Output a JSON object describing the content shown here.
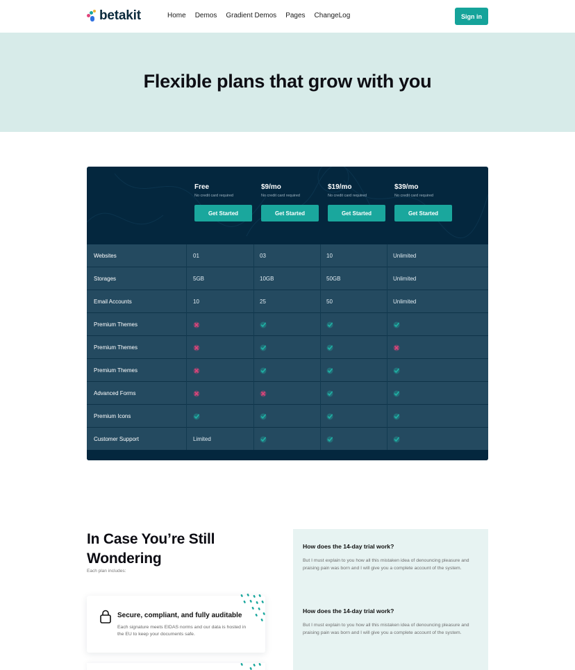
{
  "nav": {
    "logo_text": "betakit",
    "links": [
      "Home",
      "Demos",
      "Gradient Demos",
      "Pages",
      "ChangeLog"
    ],
    "signin_label": "Sign in"
  },
  "hero": {
    "title": "Flexible plans that grow with you"
  },
  "pricing": {
    "plans": [
      {
        "price": "Free",
        "note": "No credit card required",
        "button": "Get Started"
      },
      {
        "price": "$9/mo",
        "note": "No credit card required",
        "button": "Get Started"
      },
      {
        "price": "$19/mo",
        "note": "No credit card required",
        "button": "Get Started"
      },
      {
        "price": "$39/mo",
        "note": "No credit card required",
        "button": "Get Started"
      }
    ],
    "rows": [
      {
        "label": "Websites",
        "values": [
          "01",
          "03",
          "10",
          "Unlimited"
        ]
      },
      {
        "label": "Storages",
        "values": [
          "5GB",
          "10GB",
          "50GB",
          "Unlimited"
        ]
      },
      {
        "label": "Email Accounts",
        "values": [
          "10",
          "25",
          "50",
          "Unlimited"
        ]
      },
      {
        "label": "Premium Themes",
        "values": [
          "cross",
          "check",
          "check",
          "check"
        ]
      },
      {
        "label": "Premium Themes",
        "values": [
          "cross",
          "check",
          "check",
          "cross"
        ]
      },
      {
        "label": "Premium Themes",
        "values": [
          "cross",
          "check",
          "check",
          "check"
        ]
      },
      {
        "label": "Advanced Forms",
        "values": [
          "cross",
          "cross",
          "check",
          "check"
        ]
      },
      {
        "label": "Premium Icons",
        "values": [
          "check",
          "check",
          "check",
          "check"
        ]
      },
      {
        "label": "Customer Support",
        "values": [
          "Limited",
          "check",
          "check",
          "check"
        ]
      }
    ],
    "colors": {
      "check": "#1fb3a6",
      "cross": "#e0457b",
      "button": "#1aa79d",
      "bg": "#04273e",
      "row": "#244a60"
    }
  },
  "wonder": {
    "title": "In Case You’re Still Wondering",
    "subtitle": "Each plan includes:",
    "feature": {
      "icon": "lock-icon",
      "title": "Secure, compliant, and fully auditable",
      "desc": "Each signature meets EIDAS norms and our data is hosted in the EU to keep your documents safe."
    }
  },
  "faq": [
    {
      "q": "How does the 14-day trial work?",
      "a": "But I must explain to you how all this mistaken idea of denouncing pleasure and praising pain was born and I will give you a complete account of the system."
    },
    {
      "q": "How does the 14-day trial work?",
      "a": "But I must explain to you how all this mistaken idea of denouncing pleasure and praising pain was born and I will give you a complete account of the system."
    }
  ]
}
